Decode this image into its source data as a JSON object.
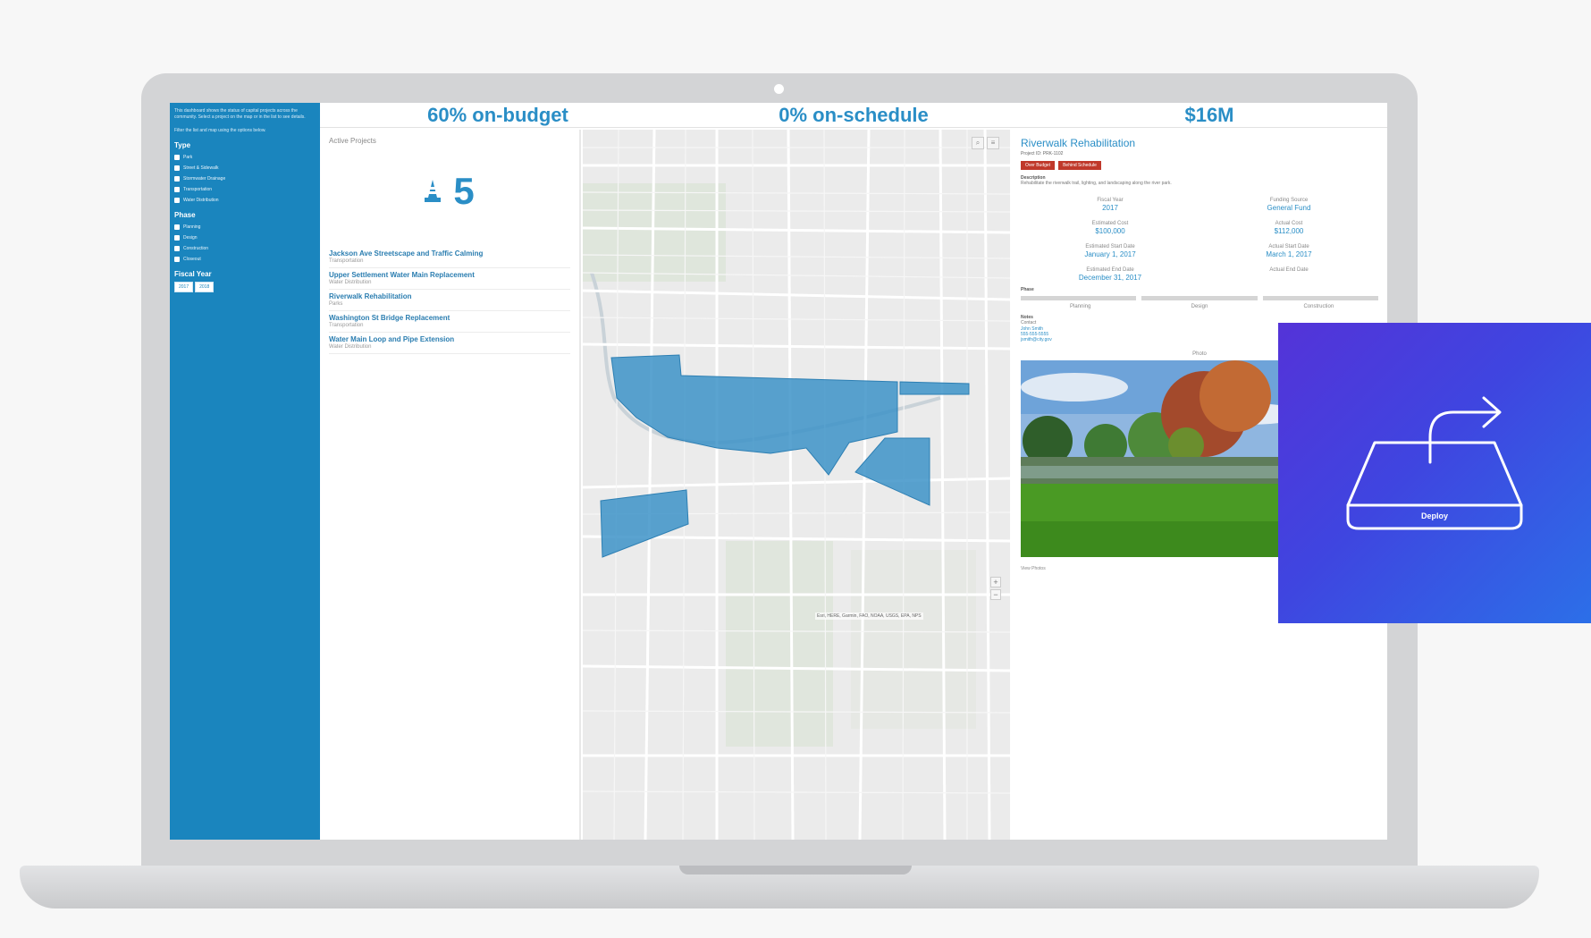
{
  "sidebar": {
    "description_1": "This dashboard shows the status of capital projects across the community. Select a project on the map or in the list to see details.",
    "description_2": "Filter the list and map using the options below.",
    "type_heading": "Type",
    "type_options": [
      "Park",
      "Street & Sidewalk",
      "Stormwater Drainage",
      "Transportation",
      "Water Distribution"
    ],
    "phase_heading": "Phase",
    "phase_options": [
      "Planning",
      "Design",
      "Construction",
      "Closeout"
    ],
    "year_heading": "Fiscal Year",
    "year_options": [
      "2017",
      "2018"
    ]
  },
  "stats": {
    "budget": "60% on-budget",
    "schedule": "0% on-schedule",
    "total": "$16M"
  },
  "projects": {
    "title": "Active Projects",
    "count": "5",
    "items": [
      {
        "name": "Jackson Ave Streetscape and Traffic Calming",
        "sub": "Transportation"
      },
      {
        "name": "Upper Settlement Water Main Replacement",
        "sub": "Water Distribution"
      },
      {
        "name": "Riverwalk Rehabilitation",
        "sub": "Parks"
      },
      {
        "name": "Washington St Bridge Replacement",
        "sub": "Transportation"
      },
      {
        "name": "Water Main Loop and Pipe Extension",
        "sub": "Water Distribution"
      }
    ]
  },
  "map": {
    "attribution": "Esri, HERE, Garmin, FAO, NOAA, USGS, EPA, NPS",
    "zoom_in": "+",
    "zoom_out": "−",
    "tool_search": "⌕",
    "tool_list": "≡"
  },
  "details": {
    "title": "Riverwalk Rehabilitation",
    "meta": "Project ID: PRK-1102",
    "badge_1": "Over Budget",
    "badge_2": "Behind Schedule",
    "desc_heading": "Description",
    "desc_text": "Rehabilitate the riverwalk trail, lighting, and landscaping along the river park.",
    "fields": [
      {
        "label": "Fiscal Year",
        "value": "2017"
      },
      {
        "label": "Funding Source",
        "value": "General Fund"
      },
      {
        "label": "Estimated Cost",
        "value": "$100,000"
      },
      {
        "label": "Actual Cost",
        "value": "$112,000"
      },
      {
        "label": "Estimated Start Date",
        "value": "January 1, 2017"
      },
      {
        "label": "Actual Start Date",
        "value": "March 1, 2017"
      },
      {
        "label": "Estimated End Date",
        "value": "December 31, 2017"
      },
      {
        "label": "Actual End Date",
        "value": ""
      }
    ],
    "phase_heading": "Phase",
    "phases": [
      "Planning",
      "Design",
      "Construction"
    ],
    "contact_heading": "Notes",
    "contact_label": "Contact",
    "contact_name": "John Smith",
    "contact_phone": "555-555-5555",
    "contact_email": "jsmith@city.gov",
    "photo_caption": "Photo",
    "photo_footer": "View Photos"
  },
  "tile": {
    "label": "Deploy",
    "icon": "deploy-tray-arrow-icon"
  }
}
